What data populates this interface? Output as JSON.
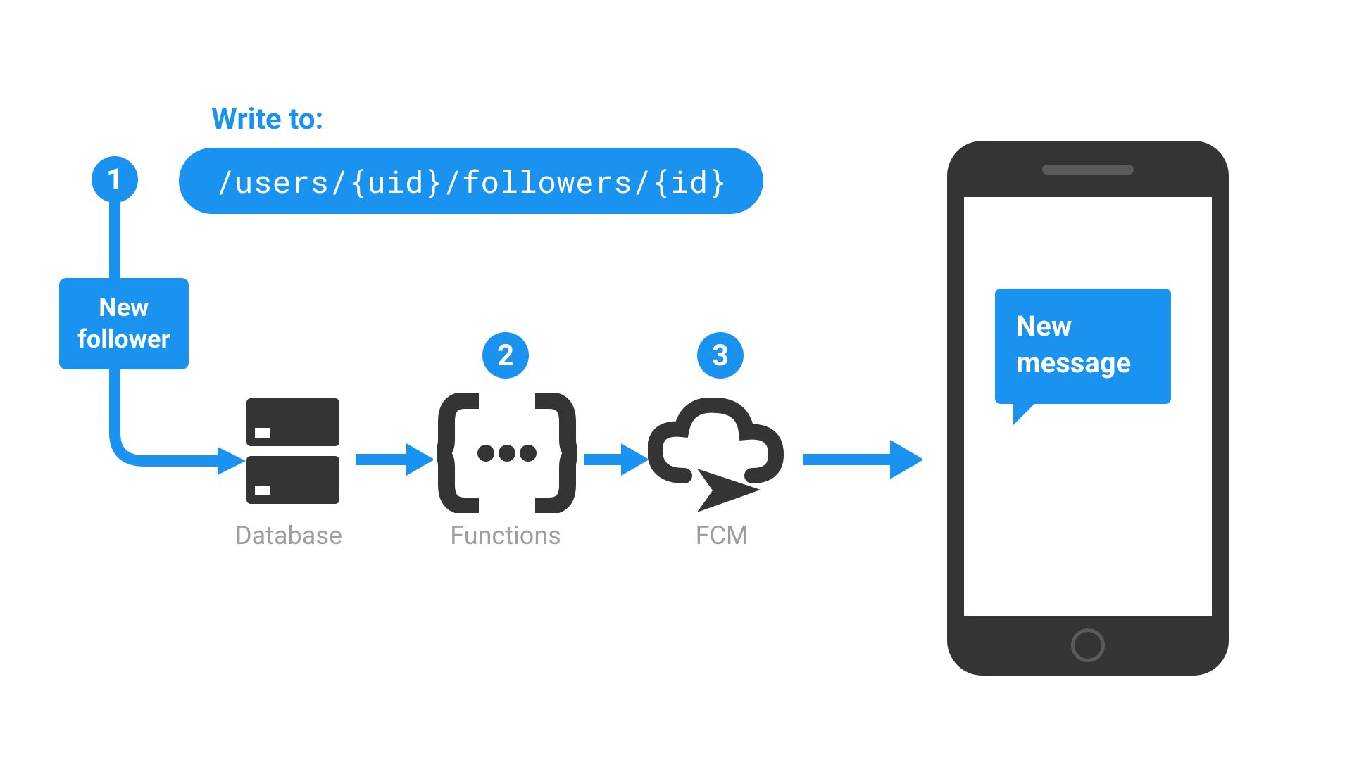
{
  "write_label": "Write to:",
  "path": "/users/{uid}/followers/{id}",
  "steps": {
    "s1": "1",
    "s2": "2",
    "s3": "3"
  },
  "trigger_box": "New\nfollower",
  "services": {
    "database": "Database",
    "functions": "Functions",
    "fcm": "FCM"
  },
  "phone_bubble": "New\nmessage",
  "colors": {
    "accent": "#1a93f0",
    "icon": "#343434",
    "muted": "#9e9e9e"
  }
}
